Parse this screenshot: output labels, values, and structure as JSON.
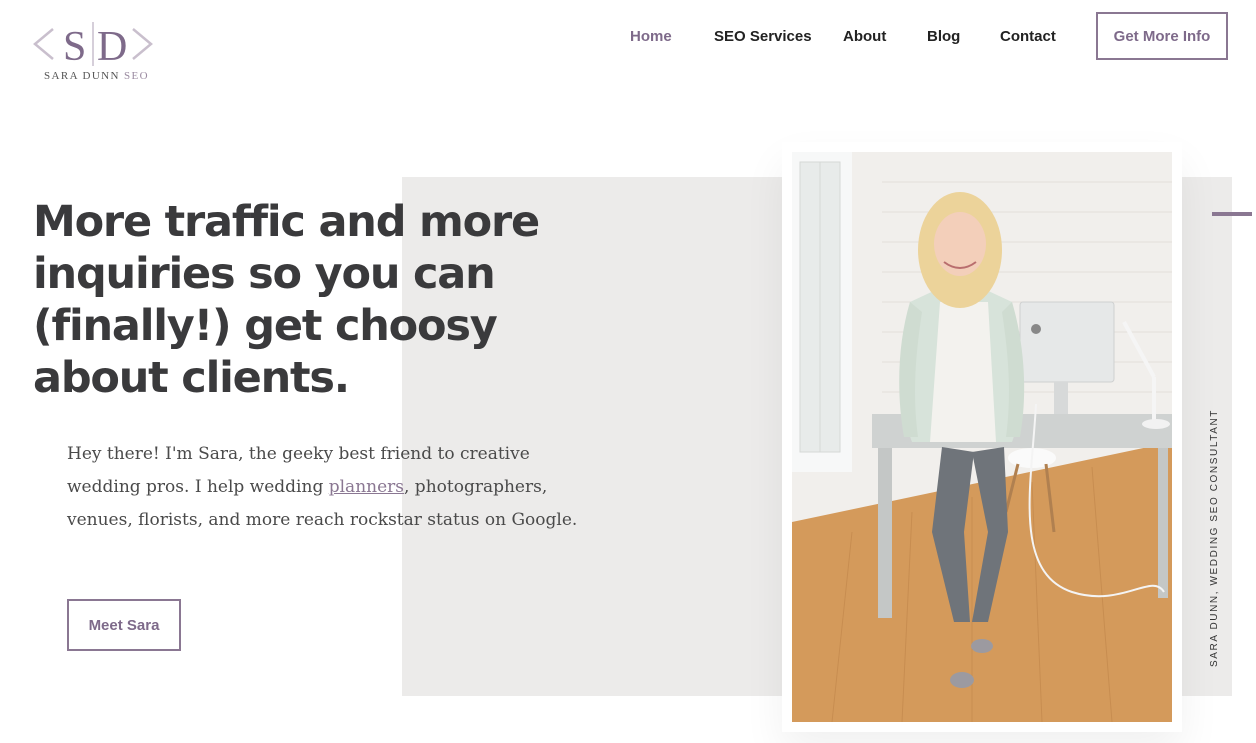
{
  "brand": {
    "logo_mark": "SD",
    "name": "SARA DUNN",
    "suffix": "SEO",
    "accent": "#8a7792",
    "light_accent": "#c9bfcd"
  },
  "nav": {
    "items": [
      {
        "label": "Home",
        "active": true
      },
      {
        "label": "SEO Services",
        "active": false
      },
      {
        "label": "About",
        "active": false
      },
      {
        "label": "Blog",
        "active": false
      },
      {
        "label": "Contact",
        "active": false
      }
    ],
    "cta_label": "Get More Info"
  },
  "hero": {
    "headline": "More traffic and more inquiries so you can (finally!) get choosy about clients.",
    "intro_before": "Hey there! I'm Sara, the geeky best friend to creative wedding pros. I help wedding ",
    "intro_link": "planners",
    "intro_after": ", photographers, venues, florists, and more reach rockstar status on Google.",
    "cta_label": "Meet Sara",
    "photo_caption": "SARA DUNN, WEDDING SEO CONSULTANT",
    "background_color": "#ecebea"
  }
}
